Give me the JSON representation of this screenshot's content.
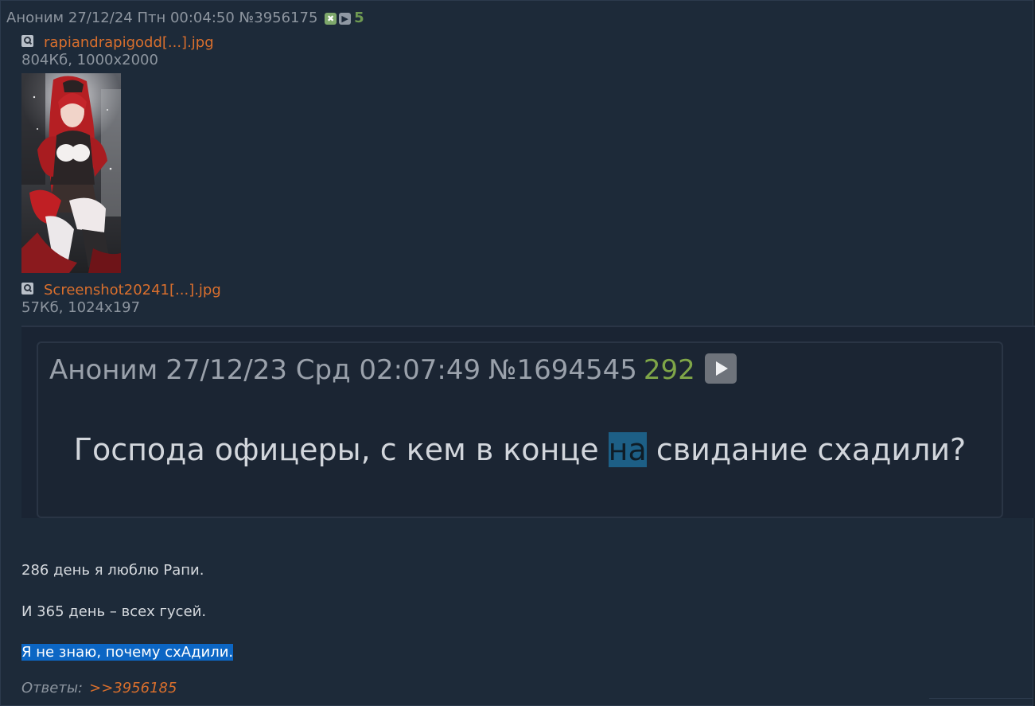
{
  "post": {
    "author": "Аноним",
    "date": "27/12/24 Птн 00:04:50",
    "number": "№3956175",
    "reply_count": "5",
    "icons": [
      "hide-post-icon",
      "play-icon"
    ]
  },
  "files": [
    {
      "name": "rapiandrapigodd[...].jpg",
      "meta": "804Кб, 1000x2000",
      "icon": "magnify-icon"
    },
    {
      "name": "Screenshot20241[...].jpg",
      "meta": "57Кб, 1024x197",
      "icon": "magnify-icon"
    }
  ],
  "screenshot_content": {
    "author": "Аноним",
    "date": "27/12/23 Срд 02:07:49",
    "number": "№1694545",
    "count": "292",
    "text_before": "Господа офицеры, с кем в конце ",
    "text_highlight": "на",
    "text_after": " свидание схадили?"
  },
  "message": {
    "line1": "286 день я люблю Рапи.",
    "line2": "И 365 день – всех гусей.",
    "line3": "Я не знаю, почему схАдили."
  },
  "answers": {
    "label": "Ответы:",
    "link": ">>3956185"
  },
  "colors": {
    "background": "#1d2a39",
    "link": "#d96f2d",
    "count": "#6f9a52",
    "selection": "#0c66c4"
  }
}
